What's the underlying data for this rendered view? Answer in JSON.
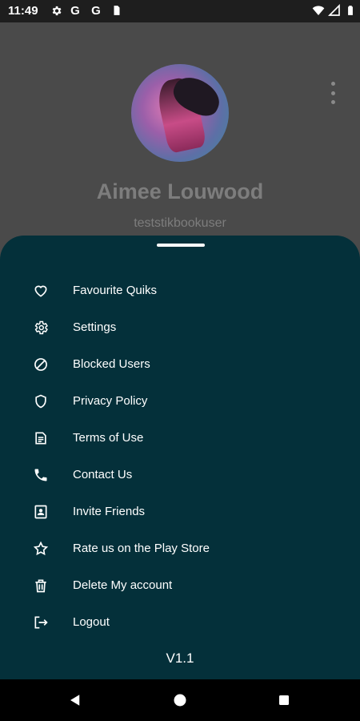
{
  "status_bar": {
    "time": "11:49",
    "left_icons": [
      "gear-icon",
      "google-g-icon",
      "google-g-icon",
      "sim-card-icon"
    ],
    "right_icons": [
      "wifi-icon",
      "cell-signal-icon",
      "battery-icon"
    ],
    "google_letter": "G"
  },
  "profile": {
    "name": "Aimee Louwood",
    "username": "teststikbookuser"
  },
  "menu": {
    "items": [
      {
        "label": "Favourite Quiks",
        "icon": "heart-icon"
      },
      {
        "label": "Settings",
        "icon": "gear-icon"
      },
      {
        "label": "Blocked Users",
        "icon": "block-icon"
      },
      {
        "label": "Privacy Policy",
        "icon": "shield-icon"
      },
      {
        "label": "Terms of Use",
        "icon": "document-icon"
      },
      {
        "label": "Contact Us",
        "icon": "phone-icon"
      },
      {
        "label": "Invite Friends",
        "icon": "contact-card-icon"
      },
      {
        "label": "Rate us on the Play Store",
        "icon": "star-icon"
      },
      {
        "label": "Delete My account",
        "icon": "trash-icon"
      },
      {
        "label": "Logout",
        "icon": "logout-icon"
      }
    ]
  },
  "version": "V1.1",
  "colors": {
    "sheet": "#04303a",
    "backdrop": "#4a4a4a",
    "text": "#ffffff",
    "dimmed_text": "#7d7d7d"
  },
  "nav_bar": [
    "back-icon",
    "home-icon",
    "recents-icon"
  ]
}
